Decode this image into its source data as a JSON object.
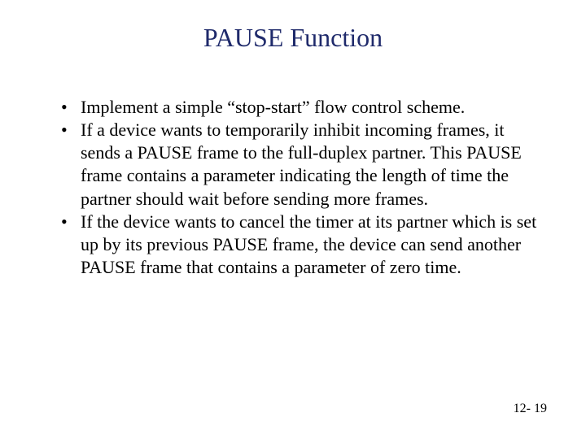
{
  "slide": {
    "title": "PAUSE Function",
    "bullets": [
      "Implement a simple “stop-start” flow control scheme.",
      "If a device wants to temporarily inhibit incoming frames, it sends a PAUSE frame to the full-duplex partner. This PAUSE frame contains a parameter indicating the length of time the partner should wait before sending more frames.",
      "If the device wants to cancel the timer at its partner which is set up by its previous PAUSE frame, the device can send another PAUSE frame that contains a parameter of zero time."
    ],
    "page_number": "12- 19"
  }
}
